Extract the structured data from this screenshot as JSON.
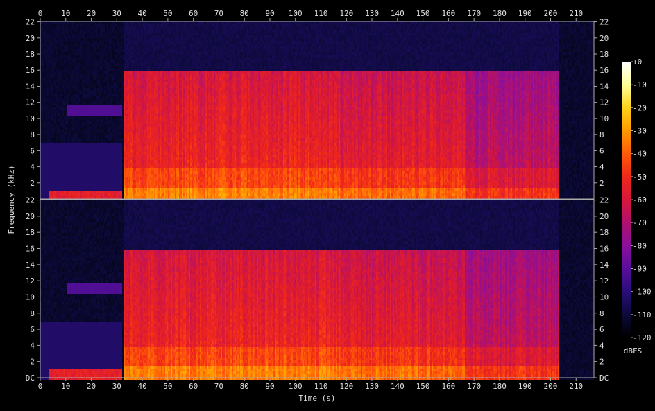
{
  "chart_data": {
    "type": "heatmap",
    "xlabel": "Time (s)",
    "ylabel": "Frequency (kHz)",
    "x_ticks": [
      "0",
      "10",
      "20",
      "30",
      "40",
      "50",
      "60",
      "70",
      "80",
      "90",
      "100",
      "110",
      "120",
      "130",
      "140",
      "150",
      "160",
      "170",
      "180",
      "190",
      "200",
      "210"
    ],
    "xlim": [
      0,
      217
    ],
    "channels": [
      {
        "y_ticks": [
          "2",
          "4",
          "6",
          "8",
          "10",
          "12",
          "14",
          "16",
          "18",
          "20",
          "22"
        ]
      },
      {
        "y_ticks": [
          "DC",
          "2",
          "4",
          "6",
          "8",
          "10",
          "12",
          "14",
          "16",
          "18",
          "20",
          "22"
        ]
      }
    ],
    "ylim_khz": [
      0,
      22.05
    ],
    "colorbar": {
      "label": "dBFS",
      "ticks": [
        "+0",
        "-10",
        "-20",
        "-30",
        "-40",
        "-50",
        "-60",
        "-70",
        "-80",
        "-90",
        "-100",
        "-110",
        "-120"
      ],
      "range": [
        -120,
        0
      ],
      "colors": [
        "#000000",
        "#0c0a3a",
        "#2a0d7a",
        "#5a0e9c",
        "#8a0f9a",
        "#b0106e",
        "#d6183a",
        "#f0281a",
        "#ff5a08",
        "#ff9a00",
        "#ffd21a",
        "#ffff9a",
        "#ffffff"
      ]
    },
    "segments": [
      {
        "t_start": 0,
        "t_end": 32.5,
        "level_db": -112,
        "bandwidth_khz": 22,
        "note": ""
      },
      {
        "t_start": 32.5,
        "t_end": 117,
        "level_db": -52,
        "bandwidth_khz": 16
      },
      {
        "t_start": 117,
        "t_end": 166,
        "level_db": -56,
        "bandwidth_khz": 16
      },
      {
        "t_start": 166,
        "t_end": 203,
        "level_db": -66,
        "bandwidth_khz": 16
      },
      {
        "t_start": 203,
        "t_end": 217,
        "level_db": -108,
        "bandwidth_khz": 22
      }
    ]
  }
}
